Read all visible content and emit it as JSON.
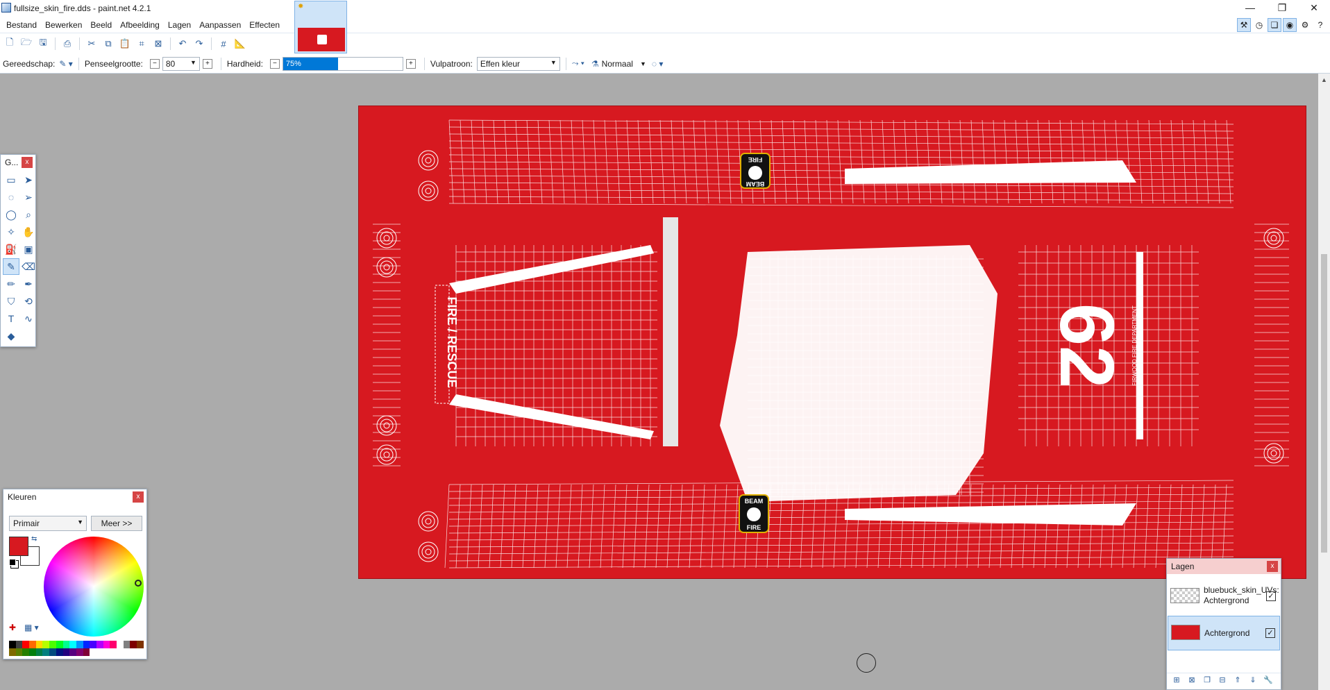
{
  "window": {
    "title": "fullsize_skin_fire.dds - paint.net 4.2.1",
    "minimize_glyph": "—",
    "maximize_glyph": "❐",
    "close_glyph": "✕"
  },
  "menu": [
    "Bestand",
    "Bewerken",
    "Beeld",
    "Afbeelding",
    "Lagen",
    "Aanpassen",
    "Effecten"
  ],
  "toolbar": {
    "icons": [
      "new-icon",
      "open-icon",
      "save-icon",
      "print-icon",
      "cut-icon",
      "copy-icon",
      "paste-icon",
      "crop-icon",
      "deselect-icon",
      "undo-icon",
      "redo-icon",
      "grid-icon",
      "ruler-icon"
    ]
  },
  "top_right_icons": [
    "tools-window-icon",
    "history-window-icon",
    "layers-window-icon",
    "colors-window-icon",
    "settings-icon",
    "help-icon"
  ],
  "tool_options": {
    "tool_label": "Gereedschap:",
    "brush_size_label": "Penseelgrootte:",
    "brush_size_value": "80",
    "hardness_label": "Hardheid:",
    "hardness_value": "75%",
    "hardness_fraction": 0.75,
    "fill_label": "Vulpatroon:",
    "fill_value": "Effen kleur",
    "blend_mode": "Normaal"
  },
  "tools_panel": {
    "title": "G...",
    "close": "x",
    "tools": [
      {
        "name": "rectangle-select-icon",
        "glyph": "▭"
      },
      {
        "name": "move-selection-icon",
        "glyph": "➤"
      },
      {
        "name": "lasso-select-icon",
        "glyph": "◌"
      },
      {
        "name": "move-selected-icon",
        "glyph": "➢"
      },
      {
        "name": "ellipse-select-icon",
        "glyph": "◯"
      },
      {
        "name": "zoom-icon",
        "glyph": "⌕"
      },
      {
        "name": "magic-wand-icon",
        "glyph": "✧"
      },
      {
        "name": "pan-icon",
        "glyph": "✋"
      },
      {
        "name": "paint-bucket-icon",
        "glyph": "⛽"
      },
      {
        "name": "gradient-icon",
        "glyph": "▣"
      },
      {
        "name": "paintbrush-icon",
        "glyph": "✎",
        "active": true
      },
      {
        "name": "eraser-icon",
        "glyph": "⌫"
      },
      {
        "name": "pencil-icon",
        "glyph": "✏"
      },
      {
        "name": "color-picker-icon",
        "glyph": "✒"
      },
      {
        "name": "clone-stamp-icon",
        "glyph": "⛉"
      },
      {
        "name": "recolor-icon",
        "glyph": "⟲"
      },
      {
        "name": "text-icon",
        "glyph": "T"
      },
      {
        "name": "line-curve-icon",
        "glyph": "∿"
      },
      {
        "name": "shapes-icon",
        "glyph": "◆"
      }
    ]
  },
  "colors_panel": {
    "title": "Kleuren",
    "close": "x",
    "mode": "Primair",
    "more_button": "Meer >>",
    "primary_color": "#d71920",
    "secondary_color": "#ffffff",
    "palette": [
      "#000000",
      "#404040",
      "#ff0000",
      "#ff6a00",
      "#ffd800",
      "#b6ff00",
      "#4cff00",
      "#00ff21",
      "#00ff90",
      "#00ffff",
      "#0094ff",
      "#0026ff",
      "#4800ff",
      "#b200ff",
      "#ff00dc",
      "#ff006e",
      "#ffffff",
      "#808080",
      "#7f0000",
      "#7f3300",
      "#7f6a00",
      "#5b7f00",
      "#267f00",
      "#007f0e",
      "#007f46",
      "#007f7f",
      "#004a7f",
      "#00137f",
      "#21007f",
      "#57007f",
      "#7f006e",
      "#7f0037"
    ]
  },
  "layers_panel": {
    "title": "Lagen",
    "close": "x",
    "layers": [
      {
        "name": "bluebuck_skin_UVs: Achtergrond",
        "visible": true,
        "selected": false
      },
      {
        "name": "Achtergrond",
        "visible": true,
        "selected": true
      }
    ],
    "footer_icons": [
      "add-layer-icon",
      "delete-layer-icon",
      "duplicate-layer-icon",
      "merge-layer-icon",
      "move-layer-up-icon",
      "move-layer-down-icon",
      "layer-properties-icon"
    ]
  },
  "canvas": {
    "background_color": "#d71920",
    "line_color": "#ffffff",
    "texts": {
      "fire_top": "FIRE",
      "fire_bottom": "FIRE",
      "fire_rescue": "FIRE / RESCUE",
      "unit_number": "62",
      "department": "FIRWOOD FIRE DEPARTMENT",
      "badge_top_1": "FIRE",
      "badge_top_2": "BEAM",
      "badge_bottom_1": "BEAM",
      "badge_bottom_2": "FIRE"
    }
  }
}
